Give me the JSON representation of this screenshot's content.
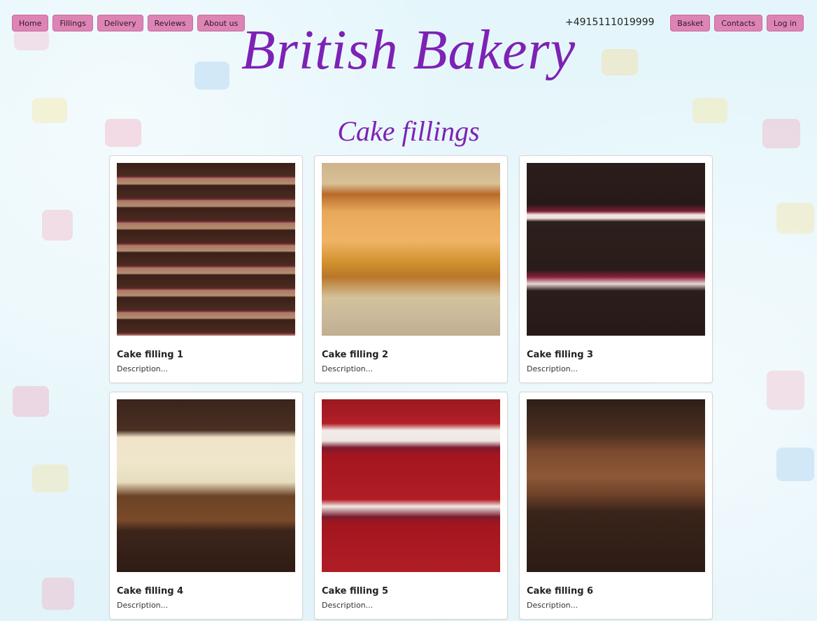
{
  "nav_left": [
    {
      "label": "Home"
    },
    {
      "label": "Fillings"
    },
    {
      "label": "Delivery"
    },
    {
      "label": "Reviews"
    },
    {
      "label": "About us"
    }
  ],
  "phone": "+4915111019999",
  "nav_right": [
    {
      "label": "Basket"
    },
    {
      "label": "Contacts"
    },
    {
      "label": "Log in"
    }
  ],
  "logo": "British Bakery",
  "section_title": "Cake fillings",
  "cards": [
    {
      "title": "Cake filling 1",
      "description": "Description..."
    },
    {
      "title": "Cake filling 2",
      "description": "Description..."
    },
    {
      "title": "Cake filling 3",
      "description": "Description..."
    },
    {
      "title": "Cake filling 4",
      "description": "Description..."
    },
    {
      "title": "Cake filling 5",
      "description": "Description..."
    },
    {
      "title": "Cake filling 6",
      "description": "Description..."
    }
  ],
  "colors": {
    "accent": "#7d22b4",
    "button": "#dd84b5",
    "background": "#e4f6fb"
  }
}
